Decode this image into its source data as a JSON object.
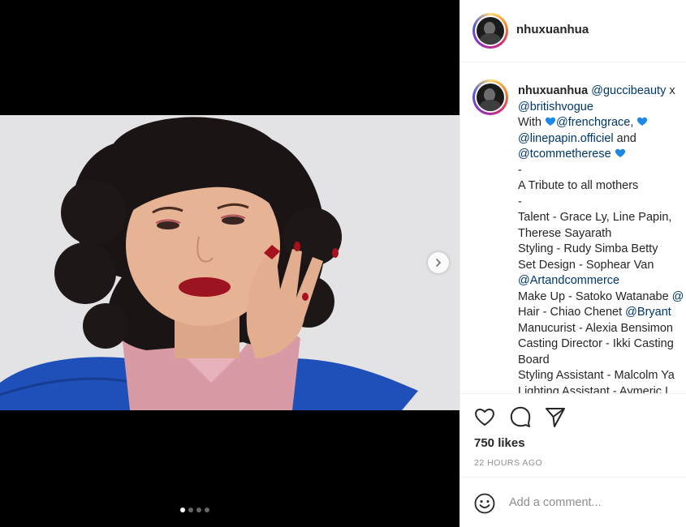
{
  "post": {
    "username": "nhuxuanhua",
    "image_alt": "Woman with dark curly hair, red lipstick, pink blouse and blue coat, hand raised to cheek",
    "carousel": {
      "total": 4,
      "active": 1
    }
  },
  "caption": {
    "username": "nhuxuanhua",
    "line1_tag": "@guccibeauty",
    "line1_text": " x",
    "line2_tag": "@britishvogue",
    "line3_text": "With ",
    "line3_tag": "@frenchgrace",
    "line3_text2": ",",
    "line4_tag": "@linepapin.officiel",
    "line4_text": " and",
    "line5_tag": "@tcommetherese",
    "line6": "-",
    "line7": "A Tribute to all mothers",
    "line8": "-",
    "line9": "Talent - Grace Ly, Line Papin,",
    "line10": "Therese Sayarath",
    "line11": "Styling - Rudy Simba Betty",
    "line12": "Set Design - Sophear Van",
    "line13_tag": "@Artandcommerce",
    "line14_text": "Make Up - Satoko Watanabe ",
    "line14_tag": "@",
    "line15_text": "Hair - Chiao Chenet ",
    "line15_tag": "@Bryant",
    "line16": "Manucurist - Alexia Bensimon",
    "line17": "Casting Director - Ikki Casting",
    "line18": "Board",
    "line19": "Styling Assistant - Malcolm Ya",
    "line20": "Lighting Assistant - Aymeric L"
  },
  "actions": {
    "likes": "750 likes",
    "time": "22 HOURS AGO"
  },
  "comment": {
    "placeholder": "Add a comment..."
  },
  "colors": {
    "link": "#00376b",
    "heart_emoji": "#1e88e5",
    "muted": "#8e8e8e"
  }
}
